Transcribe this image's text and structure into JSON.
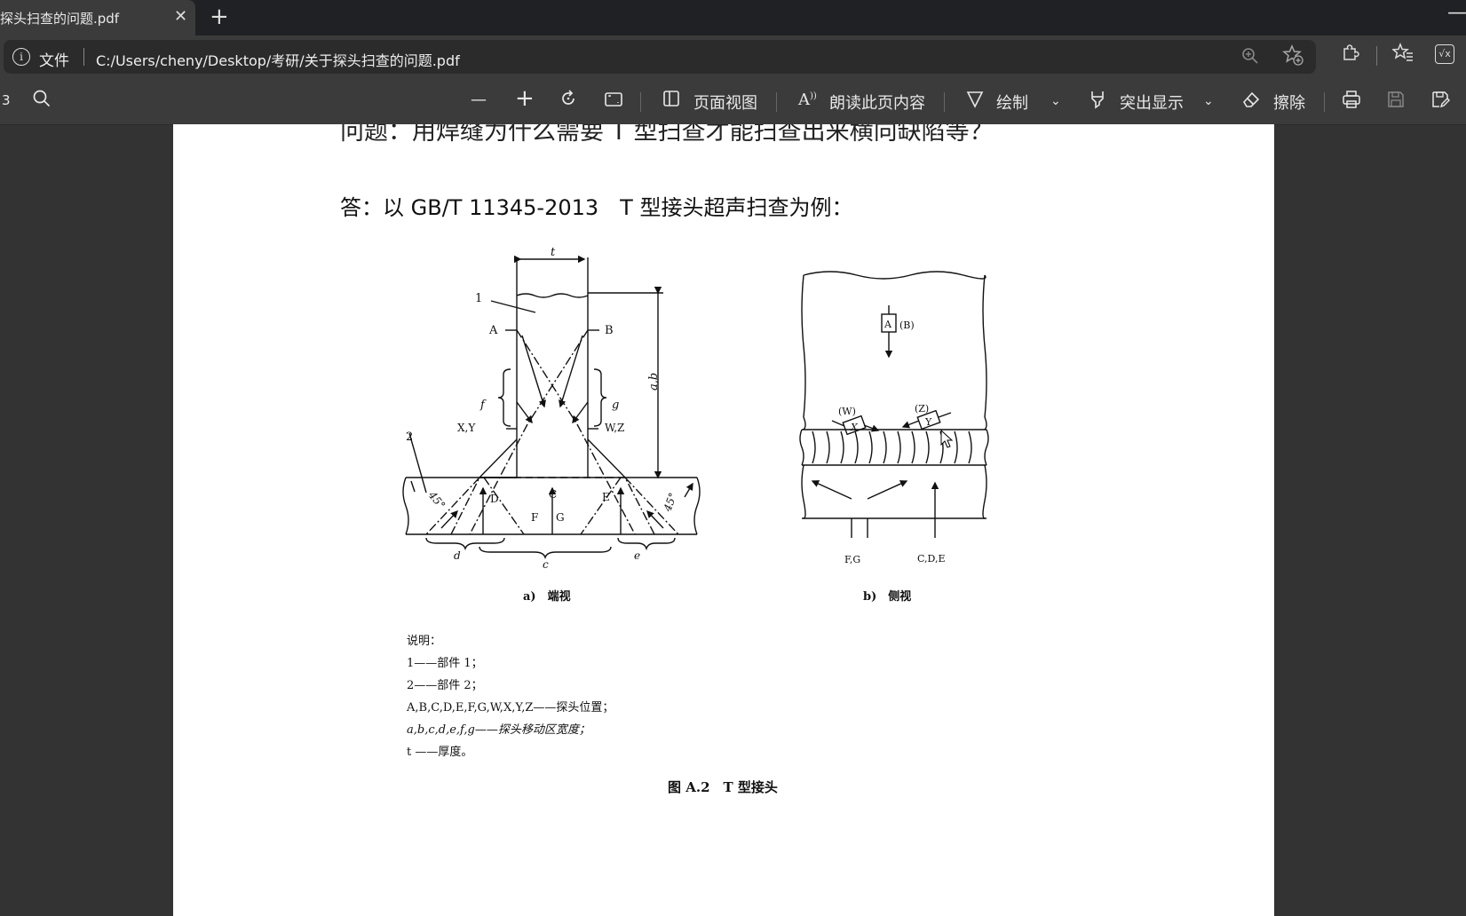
{
  "tab": {
    "title": "探头扫查的问题.pdf",
    "close": "✕",
    "new_tab": "+"
  },
  "window": {
    "minimize": "—"
  },
  "address": {
    "info": "i",
    "label": "文件",
    "url": "C:/Users/cheny/Desktop/考研/关于探头扫查的问题.pdf"
  },
  "toolbar": {
    "page_num": "3",
    "zoom_out": "—",
    "zoom_in": "+",
    "page_view": "页面视图",
    "read_aloud": "朗读此页内容",
    "draw": "绘制",
    "highlight": "突出显示",
    "erase": "擦除"
  },
  "icons": {
    "info": "info-icon",
    "zoom": "zoom-icon",
    "favorite_add": "star-plus-icon",
    "extensions": "puzzle-icon",
    "favorites": "favorites-icon",
    "collections": "collections-icon",
    "search": "search-icon",
    "rotate": "rotate-icon",
    "fit": "fit-page-icon",
    "print": "print-icon",
    "save": "save-icon",
    "save_as": "save-as-icon"
  },
  "document": {
    "question_partial": "问题：用焊缝为什么需要 T 型扫查才能扫查出来横向缺陷等？",
    "answer": "答：以 GB/T 11345-2013　T 型接头超声扫查为例：",
    "figure": {
      "labels": {
        "t": "t",
        "one": "1",
        "two": "2",
        "A": "A",
        "B": "B",
        "ab": "a,b",
        "f": "f",
        "g": "g",
        "XY": "X,Y",
        "WZ": "W,Z",
        "C": "C",
        "D": "D",
        "E": "E",
        "F": "F",
        "G": "G",
        "angle_left": "45°",
        "angle_right": "45°",
        "d": "d",
        "c": "c",
        "e": "e",
        "side_A": "A",
        "side_B": "(B)",
        "side_W": "(W)",
        "side_X": "X",
        "side_Z": "(Z)",
        "side_Y": "Y",
        "FG": "F,G",
        "CDE": "C,D,E"
      },
      "caption_a": "a)　端视",
      "caption_b": "b)　侧视"
    },
    "legend": {
      "title": "说明：",
      "item1": "1——部件 1；",
      "item2": "2——部件 2；",
      "item3": "A,B,C,D,E,F,G,W,X,Y,Z——探头位置；",
      "item4": "a,b,c,d,e,f,g——探头移动区宽度；",
      "item5": "t ——厚度。"
    },
    "figure_caption": "图 A.2　T 型接头"
  }
}
